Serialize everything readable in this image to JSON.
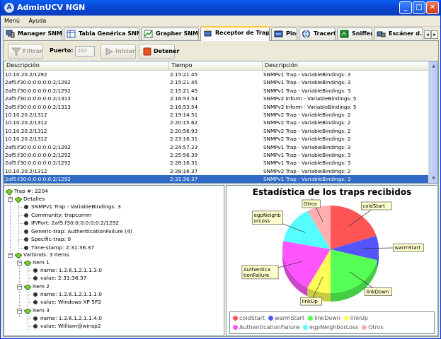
{
  "window": {
    "title": "AdminUCV NGN",
    "minimize": "_",
    "maximize": "□",
    "close": "✕"
  },
  "menu": [
    "Menú",
    "Ayuda"
  ],
  "tabs": [
    {
      "label": "Manager SNMP",
      "icon": "manager-icon",
      "active": false
    },
    {
      "label": "Tabla Genérica SNMP",
      "icon": "table-icon",
      "active": false
    },
    {
      "label": "Grapher SNMP",
      "icon": "grapher-icon",
      "active": false
    },
    {
      "label": "Receptor de Traps",
      "icon": "trap-receiver-icon",
      "active": true
    },
    {
      "label": "Ping",
      "icon": "ping-icon",
      "active": false
    },
    {
      "label": "Tracert",
      "icon": "globe-icon",
      "active": false
    },
    {
      "label": "Sniffer",
      "icon": "sniffer-icon",
      "active": false
    },
    {
      "label": "Escáner d...",
      "icon": "scanner-icon",
      "active": false
    }
  ],
  "tab_scroll": {
    "left": "◂",
    "right": "▸"
  },
  "toolbar": {
    "filter_label": "Filtrar",
    "port_label": "Puerto:",
    "port_value": "162",
    "start_label": "Iniciar",
    "stop_label": "Detener"
  },
  "table": {
    "columns": [
      "Descripción",
      "Tiempo",
      "Descripción"
    ],
    "rows": [
      [
        "10.10.20.2/1292",
        "2:15:21.45",
        "SNMPv1 Trap - VariableBindings: 3"
      ],
      [
        "2af5:f30:0:0:0:0:0:2/1292",
        "2:15:21.45",
        "SNMPv1 Trap - VariableBindings: 3"
      ],
      [
        "2af5:f30:0:0:0:0:0:2/1292",
        "2:15:21.45",
        "SNMPv1 Trap - VariableBindings: 3"
      ],
      [
        "2af5:f30:0:0:0:0:0:2/1313",
        "2:16:53.54",
        "SNMPv2 Inform - VariableBindings: 5"
      ],
      [
        "2af5:f30:0:0:0:0:0:2/1313",
        "2:16:53.54",
        "SNMPv2 Inform - VariableBindings: 5"
      ],
      [
        "10.10.20.2/1312",
        "2:19:14.51",
        "SNMPv2 Trap - VariableBindings: 2"
      ],
      [
        "10.10.20.2/1312",
        "2:20:15.62",
        "SNMPv2 Trap - VariableBindings: 2"
      ],
      [
        "10.10.20.2/1312",
        "2:20:56.93",
        "SNMPv2 Trap - VariableBindings: 2"
      ],
      [
        "10.10.20.2/1312",
        "2:23:16.31",
        "SNMPv2 Trap - VariableBindings: 2"
      ],
      [
        "2af5:f30:0:0:0:0:0:2/1292",
        "2:24:57.23",
        "SNMPv1 Trap - VariableBindings: 3"
      ],
      [
        "2af5:f30:0:0:0:0:0:2/1292",
        "2:25:56.39",
        "SNMPv1 Trap - VariableBindings: 3"
      ],
      [
        "2af5:f30:0:0:0:0:0:2/1292",
        "2:28:16.31",
        "SNMPv1 Trap - VariableBindings: 3"
      ],
      [
        "10.10.20.2/1312",
        "2:28:16.37",
        "SNMPv2 Trap - VariableBindings: 2"
      ],
      [
        "2af5:f30:0:0:0:0:0:2/1292",
        "2:31:36.37",
        "SNMPv1 Trap - VariableBindings: 3"
      ]
    ],
    "selected_row": 13
  },
  "tree": {
    "root": "Trap #: 2204",
    "details_label": "Detalles",
    "details": [
      "SNMPv1 Trap - VariableBindings: 3",
      "Community: trapcomm",
      "IP/Port: 2af5:f30:0:0:0:0:0:2/1292",
      "Generic-trap: AuthenticationFailure (4)",
      "Specific-trap: 0",
      "Time-stamp: 2:31:36.37"
    ],
    "varbinds_label": "Varbinds: 3 Items",
    "items": [
      {
        "label": "Item 1",
        "name": "name: 1.3.6.1.2.1.1.3.0",
        "value": "value: 2:31:36.37"
      },
      {
        "label": "Item 2",
        "name": "name: 1.3.6.1.2.1.1.1.0",
        "value": "value: Windows XP 5P2"
      },
      {
        "label": "Item 3",
        "name": "name: 1.3.6.1.2.1.1.4.0",
        "value": "value: William@winsp2"
      }
    ]
  },
  "chart_data": {
    "type": "pie",
    "title": "Estadística de los traps recibidos",
    "categories": [
      "coldStart",
      "warmStart",
      "linkDown",
      "linkUp",
      "AuthenticationFailure",
      "egpNeighborLoss",
      "Otros"
    ],
    "values": [
      20,
      9,
      21,
      8,
      20,
      14,
      8
    ],
    "colors": [
      "#ff5555",
      "#5555ff",
      "#55ff55",
      "#ffff55",
      "#ff55ff",
      "#55ffff",
      "#ffafaf"
    ],
    "slice_labels": [
      "coldStart",
      "warmStart",
      "linkDown",
      "linkUp",
      "Authentica tionFailure",
      "egpNeighb orLoss",
      "Otros"
    ],
    "legend": "bottom"
  }
}
